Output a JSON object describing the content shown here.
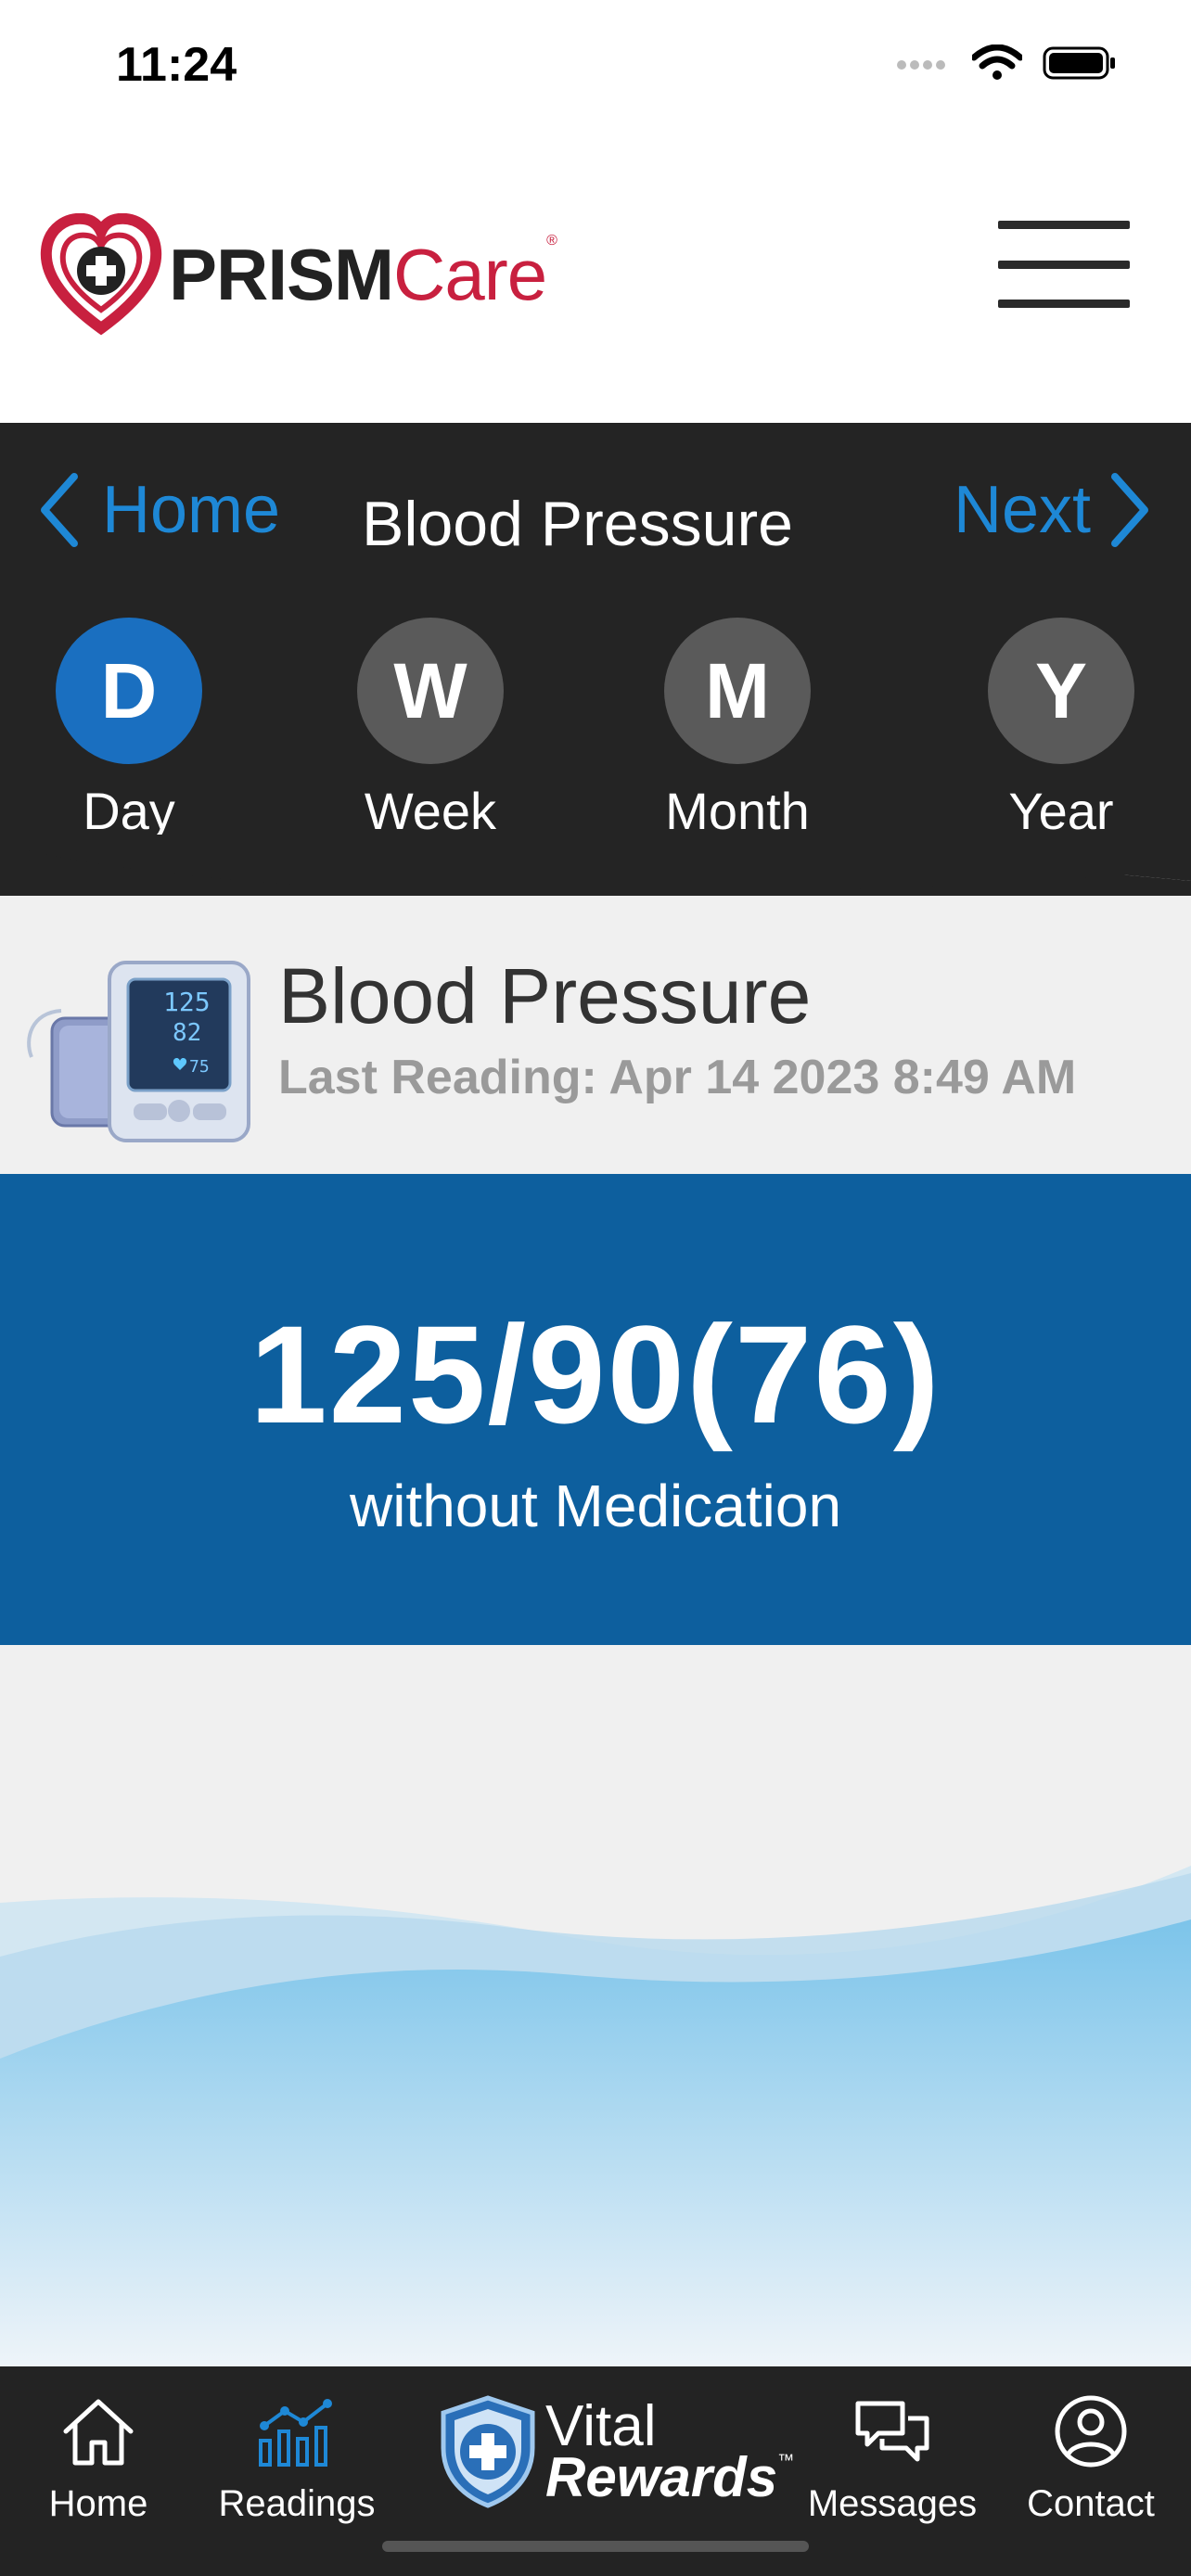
{
  "status_bar": {
    "time": "11:24"
  },
  "header": {
    "logo_prism": "PRISM",
    "logo_care": "Care",
    "logo_reg": "®"
  },
  "nav": {
    "back_label": "Home",
    "title": "Blood Pressure",
    "next_label": "Next"
  },
  "periods": [
    {
      "letter": "D",
      "label": "Day",
      "active": true
    },
    {
      "letter": "W",
      "label": "Week",
      "active": false
    },
    {
      "letter": "M",
      "label": "Month",
      "active": false
    },
    {
      "letter": "Y",
      "label": "Year",
      "active": false
    }
  ],
  "reading": {
    "title": "Blood Pressure",
    "last_reading": "Last Reading: Apr 14 2023 8:49 AM",
    "value": "125/90(76)",
    "note": "without Medication",
    "device_screen": {
      "sys": "125",
      "dia": "82",
      "pulse": "75"
    }
  },
  "tabbar": {
    "home": "Home",
    "readings": "Readings",
    "vital_line1": "Vital",
    "vital_line2": "Rewards",
    "vital_tm": "™",
    "messages": "Messages",
    "contact": "Contact"
  },
  "colors": {
    "accent": "#1e88d6",
    "value_bg": "#0d5f9e",
    "brand_red": "#c8203f",
    "dark": "#242424"
  }
}
